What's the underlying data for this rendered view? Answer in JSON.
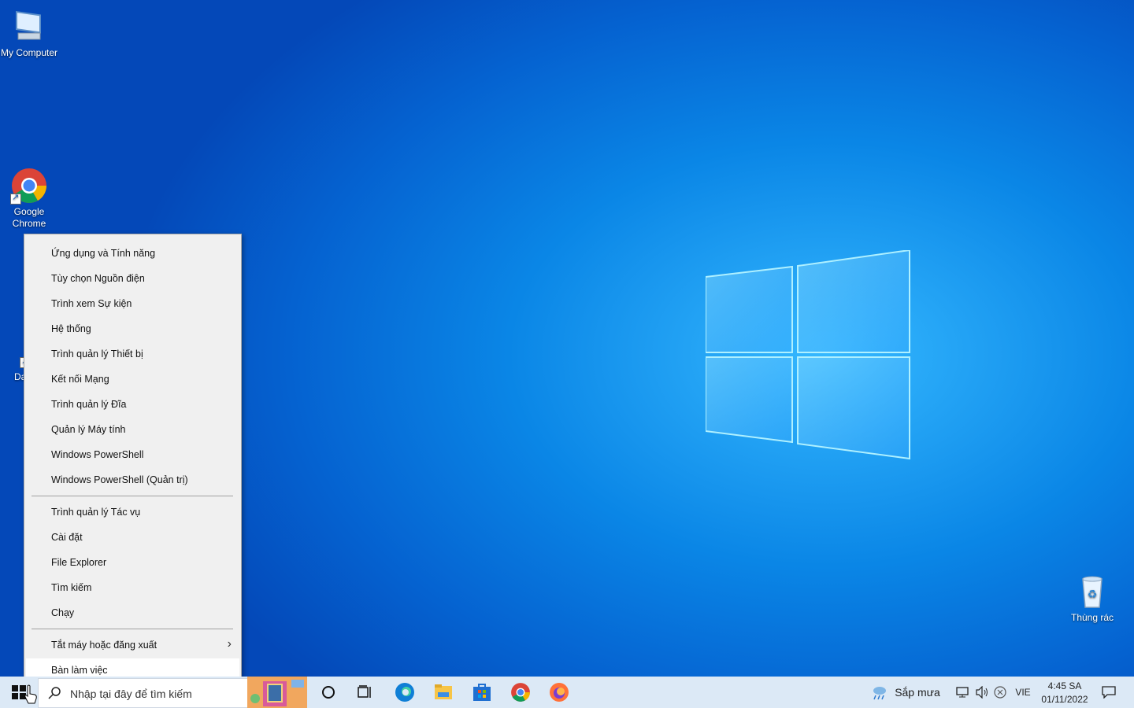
{
  "desktop": {
    "icons": [
      {
        "label": "My Computer",
        "icon": "computer-icon"
      },
      {
        "label": "Google Chrome",
        "icon": "chrome-icon"
      },
      {
        "label": "DataV",
        "icon": "app-shortcut-icon"
      },
      {
        "label": "Thùng rác",
        "icon": "recycle-bin-icon"
      }
    ]
  },
  "context_menu": {
    "group1": [
      "Ứng dụng và Tính năng",
      "Tùy chọn Nguồn điện",
      "Trình xem Sự kiện",
      "Hệ thống",
      "Trình quản lý Thiết bị",
      "Kết nối Mạng",
      "Trình quản lý Đĩa",
      "Quản lý Máy tính",
      "Windows PowerShell",
      "Windows PowerShell (Quản trị)"
    ],
    "group2": [
      "Trình quản lý Tác vụ",
      "Cài đặt",
      "File Explorer",
      "Tìm kiếm",
      "Chạy"
    ],
    "shutdown": "Tắt máy hoặc đăng xuất",
    "desktop": "Bàn làm việc"
  },
  "taskbar": {
    "search_placeholder": "Nhập tại đây để tìm kiếm",
    "weather": "Sắp mưa",
    "language": "VIE",
    "time": "4:45 SA",
    "date": "01/11/2022",
    "apps": [
      "cortana-icon",
      "task-view-icon",
      "edge-icon",
      "file-explorer-icon",
      "store-icon",
      "chrome-icon",
      "firefox-icon"
    ]
  }
}
